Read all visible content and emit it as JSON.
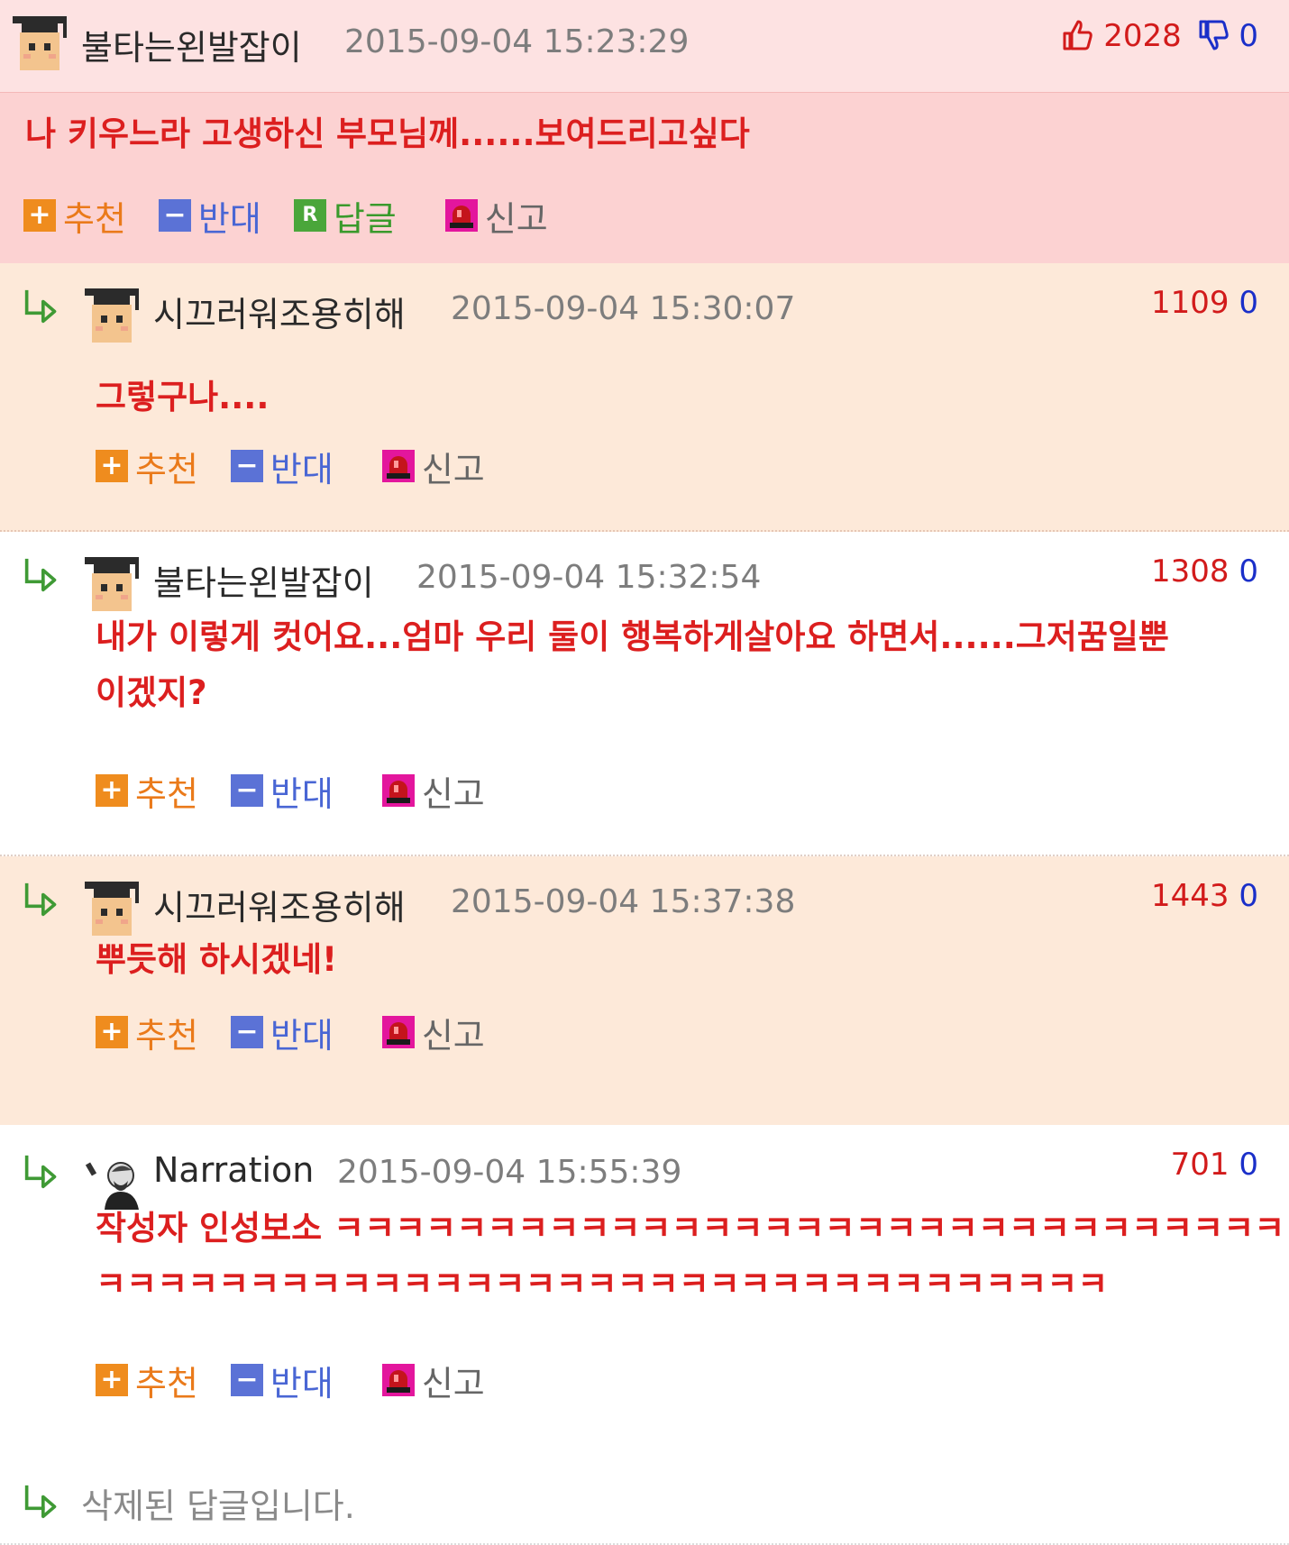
{
  "comments": [
    {
      "nick": "불타는왼발잡이",
      "date": "2015-09-04 15:23:29",
      "up": "2028",
      "down": "0",
      "lines": [
        "나 키우느라 고생하신 부모님께......보여드리고싶다"
      ],
      "actions": {
        "recommend": "추천",
        "oppose": "반대",
        "reply": "답글",
        "report": "신고"
      }
    },
    {
      "nick": "시끄러워조용히해",
      "date": "2015-09-04 15:30:07",
      "up": "1109",
      "down": "0",
      "lines": [
        "그렇구나...."
      ],
      "actions": {
        "recommend": "추천",
        "oppose": "반대",
        "report": "신고"
      }
    },
    {
      "nick": "불타는왼발잡이",
      "date": "2015-09-04 15:32:54",
      "up": "1308",
      "down": "0",
      "lines": [
        "내가 이렇게 컷어요...엄마 우리 둘이 행복하게살아요 하면서......그저꿈일뿐",
        "이겠지?"
      ],
      "actions": {
        "recommend": "추천",
        "oppose": "반대",
        "report": "신고"
      }
    },
    {
      "nick": "시끄러워조용히해",
      "date": "2015-09-04 15:37:38",
      "up": "1443",
      "down": "0",
      "lines": [
        "뿌듯해 하시겠네!"
      ],
      "actions": {
        "recommend": "추천",
        "oppose": "반대",
        "report": "신고"
      }
    },
    {
      "nick": "Narration",
      "date": "2015-09-04 15:55:39",
      "up": "701",
      "down": "0",
      "lines": [
        "작성자 인성보소 ㅋㅋㅋㅋㅋㅋㅋㅋㅋㅋㅋㅋㅋㅋㅋㅋㅋㅋㅋㅋㅋㅋㅋㅋㅋㅋㅋㅋㅋㅋㅋ",
        "ㅋㅋㅋㅋㅋㅋㅋㅋㅋㅋㅋㅋㅋㅋㅋㅋㅋㅋㅋㅋㅋㅋㅋㅋㅋㅋㅋㅋㅋㅋㅋㅋㅋ"
      ],
      "actions": {
        "recommend": "추천",
        "oppose": "반대",
        "report": "신고"
      }
    }
  ],
  "deleted_text": "삭제된 답글입니다.",
  "colors": {
    "upvote": "#d21b1b",
    "downvote": "#1a2fc9",
    "comment_text": "#dc1f1f",
    "best_bg": "#fcd2d2",
    "reply_bg": "#fde9d9"
  },
  "icons": {
    "reply_arrow": "reply-arrow-icon",
    "thumbs_up": "thumbs-up-icon",
    "thumbs_down": "thumbs-down-icon",
    "report": "siren-icon",
    "avatar": "graduate-avatar-icon"
  }
}
